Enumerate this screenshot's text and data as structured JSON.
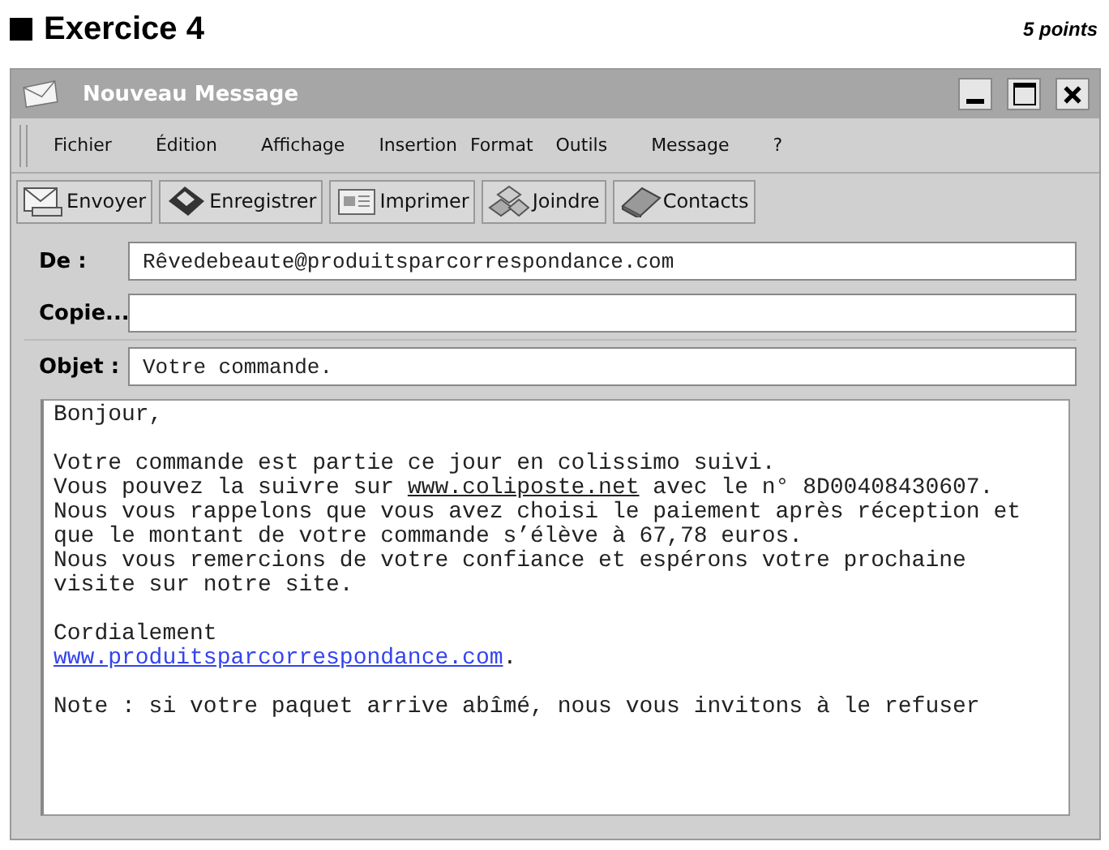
{
  "heading": {
    "title": "Exercice 4",
    "points": "5 points"
  },
  "window": {
    "title": "Nouveau Message",
    "controls": [
      {
        "kind": "minimize"
      },
      {
        "kind": "maximize"
      },
      {
        "kind": "close"
      }
    ]
  },
  "menu": [
    "Fichier",
    "Édition",
    "Affichage",
    "Insertion",
    "Format",
    "Outils",
    "Message",
    "?"
  ],
  "toolbar": [
    {
      "label": "Envoyer",
      "kind": "send"
    },
    {
      "label": "Enregistrer",
      "kind": "save"
    },
    {
      "label": "Imprimer",
      "kind": "print"
    },
    {
      "label": "Joindre",
      "kind": "attach"
    },
    {
      "label": "Contacts",
      "kind": "contacts"
    }
  ],
  "fields": [
    {
      "label": "De :",
      "value": "Rêvedebeaute@produitsparcorrespondance.com"
    },
    {
      "label": "Copie..."
    },
    {
      "label": "Objet :",
      "value": "Votre commande."
    }
  ],
  "body": [
    [
      [
        {
          "kind": "text",
          "text": "Bonjour,"
        }
      ]
    ],
    [
      [
        {
          "kind": "text",
          "text": "Votre commande est partie ce jour en colissimo suivi."
        }
      ],
      [
        {
          "kind": "text",
          "text": "Vous pouvez la suivre sur "
        },
        {
          "kind": "link",
          "text": "www.coliposte.net"
        },
        {
          "kind": "text",
          "text": " avec le n° 8D00408430607."
        }
      ],
      [
        {
          "kind": "text",
          "text": "Nous vous rappelons que vous avez choisi le paiement après réception et"
        }
      ],
      [
        {
          "kind": "text",
          "text": "que le montant de votre commande s’élève à 67,78 euros."
        }
      ],
      [
        {
          "kind": "text",
          "text": "Nous vous remercions de votre confiance et espérons votre prochaine"
        }
      ],
      [
        {
          "kind": "text",
          "text": "visite sur notre site."
        }
      ]
    ],
    [
      [
        {
          "kind": "text",
          "text": "Cordialement"
        }
      ],
      [
        {
          "kind": "weblink",
          "text": "www.produitsparcorrespondance.com"
        },
        {
          "kind": "text",
          "text": "."
        }
      ]
    ],
    [
      [
        {
          "kind": "text",
          "text": "Note : si votre paquet arrive abîmé, nous vous invitons à le refuser"
        }
      ]
    ]
  ]
}
